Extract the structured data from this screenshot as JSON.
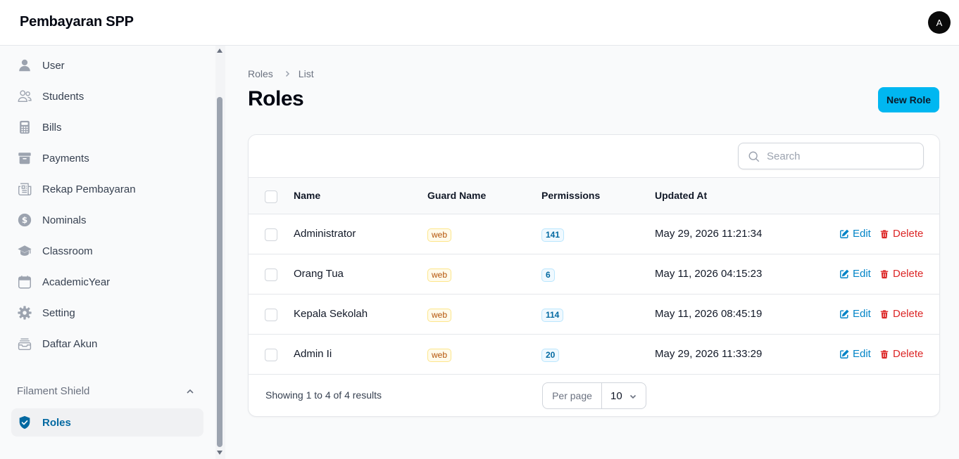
{
  "app": {
    "title": "Pembayaran SPP",
    "user_initial": "A"
  },
  "sidebar": {
    "items": [
      {
        "label": "User",
        "icon": "user-icon"
      },
      {
        "label": "Students",
        "icon": "users-icon"
      },
      {
        "label": "Bills",
        "icon": "calculator-icon"
      },
      {
        "label": "Payments",
        "icon": "archive-box-icon"
      },
      {
        "label": "Rekap Pembayaran",
        "icon": "newspaper-icon"
      },
      {
        "label": "Nominals",
        "icon": "currency-dollar-icon"
      },
      {
        "label": "Classroom",
        "icon": "academic-cap-icon"
      },
      {
        "label": "AcademicYear",
        "icon": "calendar-icon"
      },
      {
        "label": "Setting",
        "icon": "cog-icon"
      },
      {
        "label": "Daftar Akun",
        "icon": "inbox-stack-icon"
      }
    ],
    "group": {
      "label": "Filament Shield",
      "items": [
        {
          "label": "Roles",
          "icon": "shield-check-icon",
          "active": true
        }
      ]
    }
  },
  "breadcrumb": {
    "parent": "Roles",
    "current": "List"
  },
  "page": {
    "title": "Roles",
    "new_button": "New Role"
  },
  "table": {
    "search_placeholder": "Search",
    "columns": {
      "name": "Name",
      "guard": "Guard Name",
      "permissions": "Permissions",
      "updated": "Updated At"
    },
    "rows": [
      {
        "name": "Administrator",
        "guard": "web",
        "permissions": "141",
        "updated": "May 29, 2026 11:21:34"
      },
      {
        "name": "Orang Tua",
        "guard": "web",
        "permissions": "6",
        "updated": "May 11, 2026 04:15:23"
      },
      {
        "name": "Kepala Sekolah",
        "guard": "web",
        "permissions": "114",
        "updated": "May 11, 2026 08:45:19"
      },
      {
        "name": "Admin Ii",
        "guard": "web",
        "permissions": "20",
        "updated": "May 29, 2026 11:33:29"
      }
    ],
    "actions": {
      "edit": "Edit",
      "delete": "Delete"
    },
    "summary": "Showing 1 to 4 of 4 results",
    "per_page_label": "Per page",
    "per_page_value": "10"
  },
  "colors": {
    "primary": "#00b7f1",
    "link": "#0284c7",
    "danger": "#dc2626",
    "active_nav": "#0369a1"
  }
}
